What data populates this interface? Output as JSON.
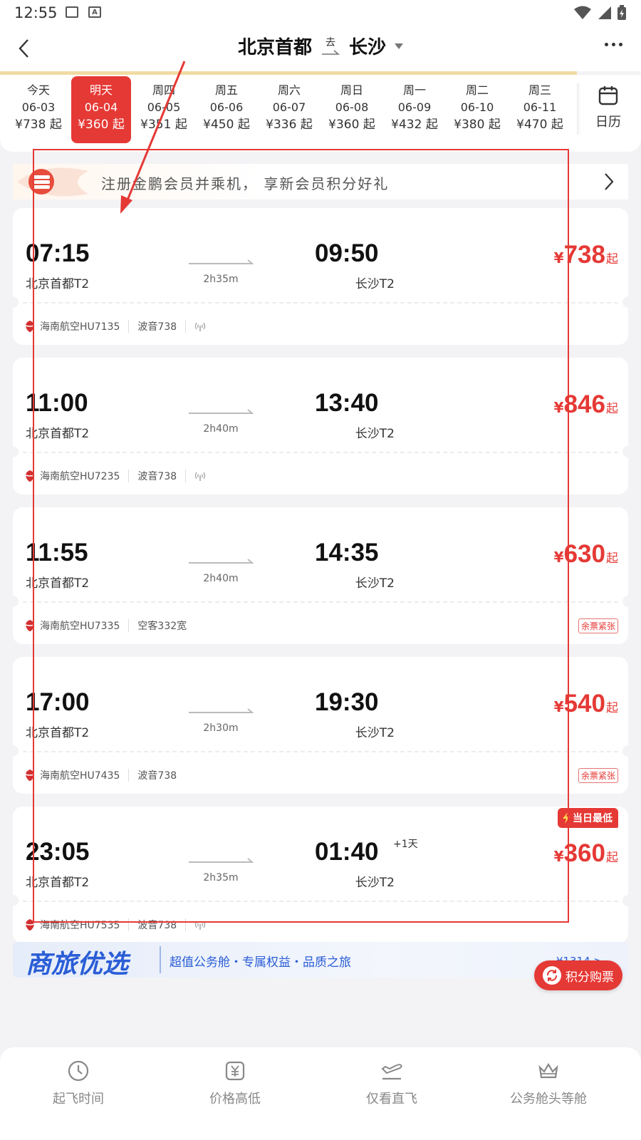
{
  "status_bar": {
    "time": "12:55"
  },
  "header": {
    "from_city": "北京首都",
    "direction_label": "去",
    "to_city": "长沙"
  },
  "dates": [
    {
      "weekday": "今天",
      "date": "06-03",
      "price": "¥738 起",
      "selected": false
    },
    {
      "weekday": "明天",
      "date": "06-04",
      "price": "¥360 起",
      "selected": true
    },
    {
      "weekday": "周四",
      "date": "06-05",
      "price": "¥351 起",
      "selected": false
    },
    {
      "weekday": "周五",
      "date": "06-06",
      "price": "¥450 起",
      "selected": false
    },
    {
      "weekday": "周六",
      "date": "06-07",
      "price": "¥336 起",
      "selected": false
    },
    {
      "weekday": "周日",
      "date": "06-08",
      "price": "¥360 起",
      "selected": false
    },
    {
      "weekday": "周一",
      "date": "06-09",
      "price": "¥432 起",
      "selected": false
    },
    {
      "weekday": "周二",
      "date": "06-10",
      "price": "¥380 起",
      "selected": false
    },
    {
      "weekday": "周三",
      "date": "06-11",
      "price": "¥470 起",
      "selected": false
    }
  ],
  "calendar": {
    "label": "日历"
  },
  "promo": {
    "text": "注册金鹏会员并乘机， 享新会员积分好礼"
  },
  "flights": [
    {
      "dep_time": "07:15",
      "dep_airport": "北京首都T2",
      "duration": "2h35m",
      "arr_time": "09:50",
      "arr_airport": "长沙T2",
      "day_offset": "",
      "currency": "¥",
      "price": "738",
      "price_suffix": "起",
      "airline": "海南航空HU7135",
      "aircraft": "波音738",
      "wifi": true,
      "tag": "",
      "lowest": ""
    },
    {
      "dep_time": "11:00",
      "dep_airport": "北京首都T2",
      "duration": "2h40m",
      "arr_time": "13:40",
      "arr_airport": "长沙T2",
      "day_offset": "",
      "currency": "¥",
      "price": "846",
      "price_suffix": "起",
      "airline": "海南航空HU7235",
      "aircraft": "波音738",
      "wifi": true,
      "tag": "",
      "lowest": ""
    },
    {
      "dep_time": "11:55",
      "dep_airport": "北京首都T2",
      "duration": "2h40m",
      "arr_time": "14:35",
      "arr_airport": "长沙T2",
      "day_offset": "",
      "currency": "¥",
      "price": "630",
      "price_suffix": "起",
      "airline": "海南航空HU7335",
      "aircraft": "空客332宽",
      "wifi": false,
      "tag": "余票紧张",
      "lowest": ""
    },
    {
      "dep_time": "17:00",
      "dep_airport": "北京首都T2",
      "duration": "2h30m",
      "arr_time": "19:30",
      "arr_airport": "长沙T2",
      "day_offset": "",
      "currency": "¥",
      "price": "540",
      "price_suffix": "起",
      "airline": "海南航空HU7435",
      "aircraft": "波音738",
      "wifi": false,
      "tag": "余票紧张",
      "lowest": ""
    },
    {
      "dep_time": "23:05",
      "dep_airport": "北京首都T2",
      "duration": "2h35m",
      "arr_time": "01:40",
      "arr_airport": "长沙T2",
      "day_offset": "+1天",
      "currency": "¥",
      "price": "360",
      "price_suffix": "起",
      "airline": "海南航空HU7535",
      "aircraft": "波音738",
      "wifi": true,
      "tag": "",
      "lowest": "当日最低"
    }
  ],
  "biz_banner": {
    "title": "商旅优选",
    "subtitle": "超值公务舱・专属权益・品质之旅",
    "price": "¥1314 >"
  },
  "points_button": {
    "label": "积分购票"
  },
  "tabbar": [
    {
      "label": "起飞时间",
      "icon": "clock-icon"
    },
    {
      "label": "价格高低",
      "icon": "price-icon"
    },
    {
      "label": "仅看直飞",
      "icon": "plane-icon"
    },
    {
      "label": "公务舱头等舱",
      "icon": "crown-icon"
    }
  ],
  "colors": {
    "accent": "#e53935",
    "biz_blue": "#2a5dd6",
    "gold": "#f0dba2"
  }
}
